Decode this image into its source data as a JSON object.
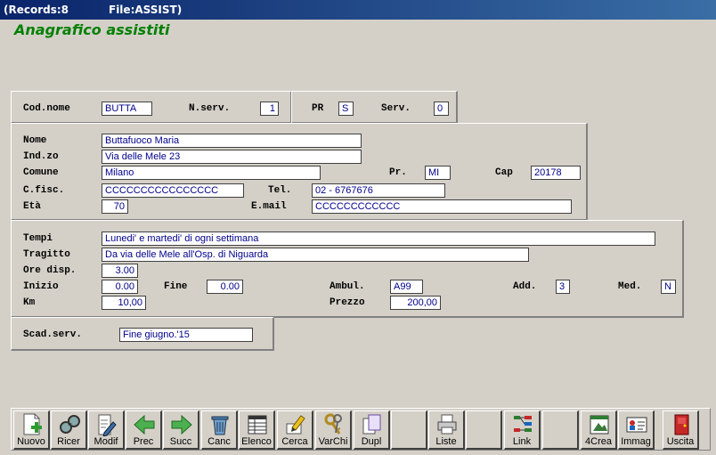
{
  "titlebar": {
    "records": "(Records:8",
    "file": "File:ASSIST)"
  },
  "app_title": "Anagrafico assistiti",
  "fields": {
    "cod_nome": {
      "label": "Cod.nome",
      "value": "BUTTA"
    },
    "n_serv": {
      "label": "N.serv.",
      "value": "1"
    },
    "pr_top": {
      "label": "PR",
      "value": "S"
    },
    "serv": {
      "label": "Serv.",
      "value": "0"
    },
    "nome": {
      "label": "Nome",
      "value": "Buttafuoco Maria"
    },
    "indirizzo": {
      "label": "Ind.zo",
      "value": "Via delle Mele 23"
    },
    "comune": {
      "label": "Comune",
      "value": "Milano"
    },
    "provincia": {
      "label": "Pr.",
      "value": "MI"
    },
    "cap": {
      "label": "Cap",
      "value": "20178"
    },
    "cfisc": {
      "label": "C.fisc.",
      "value": "CCCCCCCCCCCCCCCC"
    },
    "tel": {
      "label": "Tel.",
      "value": "02 - 6767676"
    },
    "eta": {
      "label": "Età",
      "value": "70"
    },
    "email": {
      "label": "E.mail",
      "value": "CCCCCCCCCCCC"
    },
    "tempi": {
      "label": "Tempi",
      "value": "Lunedi' e martedi' di ogni settimana"
    },
    "tragitto": {
      "label": "Tragitto",
      "value": "Da via delle Mele all'Osp. di Niguarda"
    },
    "ore_disp": {
      "label": "Ore disp.",
      "value": "3.00"
    },
    "inizio": {
      "label": "Inizio",
      "value": "0.00"
    },
    "fine": {
      "label": "Fine",
      "value": "0.00"
    },
    "ambul": {
      "label": "Ambul.",
      "value": "A99"
    },
    "add": {
      "label": "Add.",
      "value": "3"
    },
    "med": {
      "label": "Med.",
      "value": "N"
    },
    "km": {
      "label": "Km",
      "value": "10,00"
    },
    "prezzo": {
      "label": "Prezzo",
      "value": "200,00"
    },
    "scad_serv": {
      "label": "Scad.serv.",
      "value": "Fine giugno.'15"
    }
  },
  "toolbar": {
    "nuovo": "Nuovo",
    "ricer": "Ricer",
    "modif": "Modif",
    "prec": "Prec",
    "succ": "Succ",
    "canc": "Canc",
    "elenco": "Elenco",
    "cerca": "Cerca",
    "varchi": "VarChi",
    "dupl": "Dupl",
    "liste": "Liste",
    "link": "Link",
    "crea": "4Crea",
    "immag": "Immag",
    "uscita": "Uscita"
  }
}
